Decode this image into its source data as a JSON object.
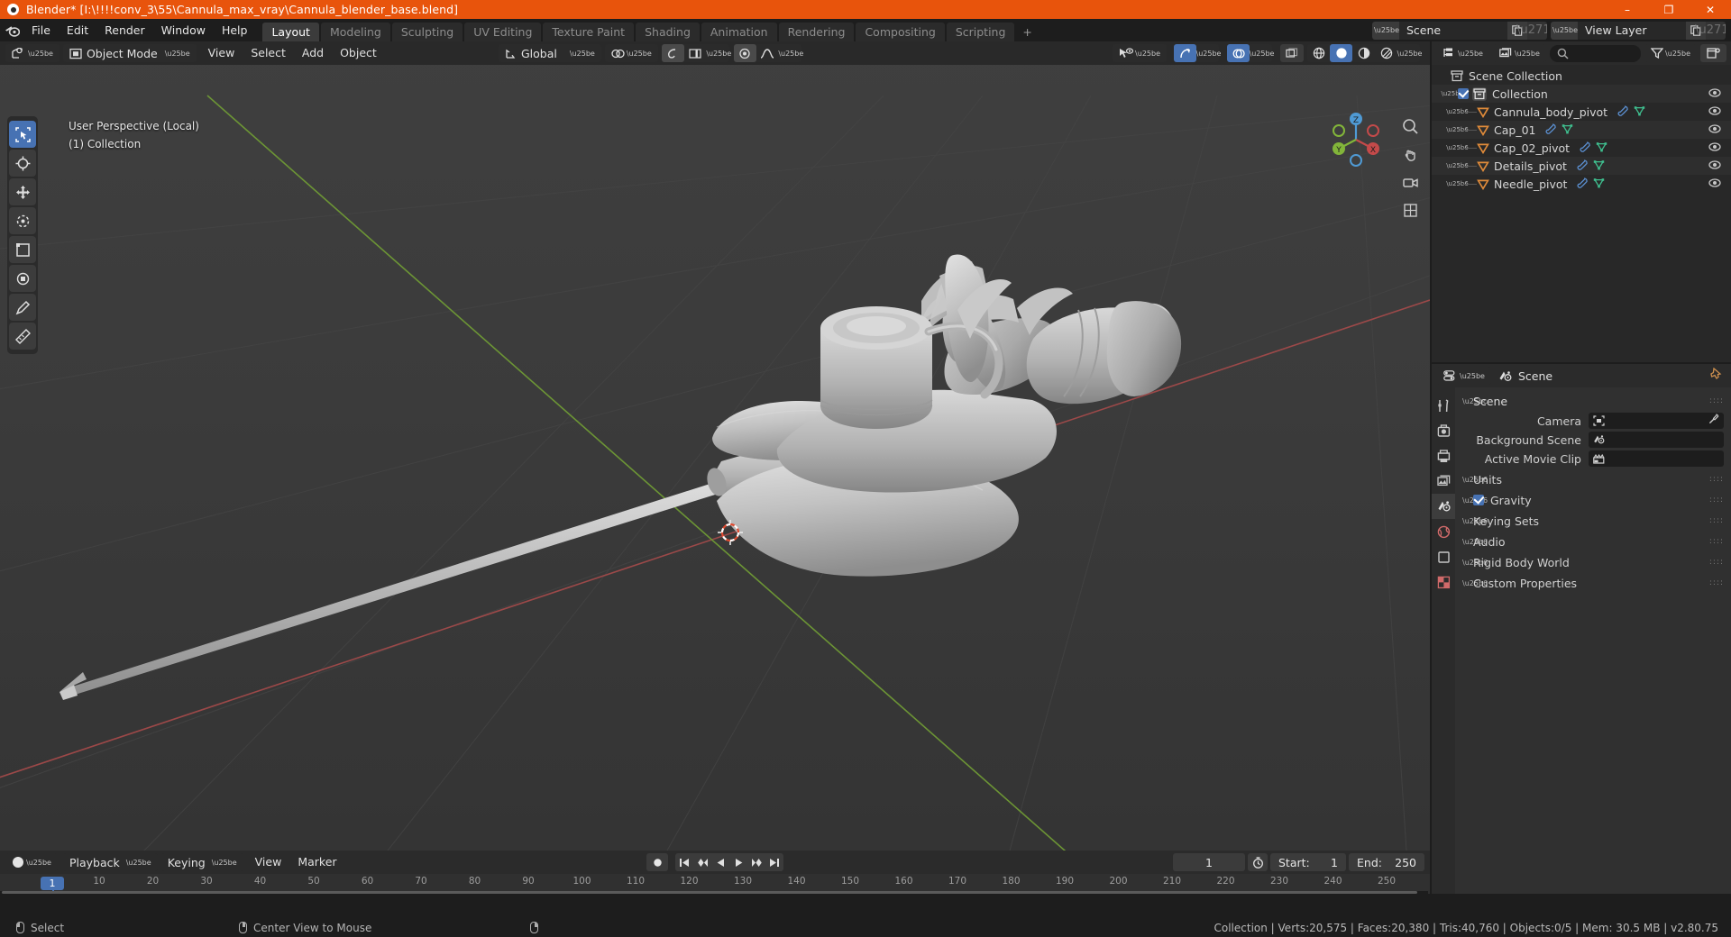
{
  "window": {
    "title": "Blender* [I:\\!!!!conv_3\\55\\Cannula_max_vray\\Cannula_blender_base.blend]",
    "minimize": "–",
    "maximize": "❐",
    "close": "✕"
  },
  "topbar": {
    "menus": [
      "File",
      "Edit",
      "Render",
      "Window",
      "Help"
    ],
    "workspaces": [
      {
        "label": "Layout",
        "active": true
      },
      {
        "label": "Modeling",
        "active": false
      },
      {
        "label": "Sculpting",
        "active": false
      },
      {
        "label": "UV Editing",
        "active": false
      },
      {
        "label": "Texture Paint",
        "active": false
      },
      {
        "label": "Shading",
        "active": false
      },
      {
        "label": "Animation",
        "active": false
      },
      {
        "label": "Rendering",
        "active": false
      },
      {
        "label": "Compositing",
        "active": false
      },
      {
        "label": "Scripting",
        "active": false
      }
    ],
    "add_workspace": "+",
    "scene_name": "Scene",
    "view_layer_name": "View Layer"
  },
  "viewport": {
    "mode": "Object Mode",
    "menus": [
      "View",
      "Select",
      "Add",
      "Object"
    ],
    "transform_orientation": "Global",
    "overlay_text_line1": "User Perspective (Local)",
    "overlay_text_line2": "(1) Collection",
    "gizmo_axes": {
      "x": "X",
      "y": "Y",
      "z": "Z"
    }
  },
  "outliner": {
    "search_placeholder": "",
    "root": "Scene Collection",
    "collection": "Collection",
    "items": [
      {
        "label": "Cannula_body_pivot"
      },
      {
        "label": "Cap_01"
      },
      {
        "label": "Cap_02_pivot"
      },
      {
        "label": "Details_pivot"
      },
      {
        "label": "Needle_pivot"
      }
    ]
  },
  "properties": {
    "breadcrumb": "Scene",
    "panel_title": "Scene",
    "rows": [
      {
        "label": "Camera",
        "value": ""
      },
      {
        "label": "Background Scene",
        "value": ""
      },
      {
        "label": "Active Movie Clip",
        "value": ""
      }
    ],
    "subpanels": [
      {
        "label": "Units",
        "checkbox": false
      },
      {
        "label": "Gravity",
        "checkbox": true
      },
      {
        "label": "Keying Sets",
        "checkbox": false
      },
      {
        "label": "Audio",
        "checkbox": false
      },
      {
        "label": "Rigid Body World",
        "checkbox": false
      },
      {
        "label": "Custom Properties",
        "checkbox": false
      }
    ]
  },
  "timeline": {
    "menus": [
      "Playback",
      "Keying",
      "View",
      "Marker"
    ],
    "current_frame": "1",
    "start_label": "Start:",
    "start_value": "1",
    "end_label": "End:",
    "end_value": "250",
    "ticks": [
      "10",
      "20",
      "30",
      "40",
      "50",
      "60",
      "70",
      "80",
      "90",
      "100",
      "110",
      "120",
      "130",
      "140",
      "150",
      "160",
      "170",
      "180",
      "190",
      "200",
      "210",
      "220",
      "230",
      "240",
      "250"
    ],
    "playhead_frame": "1"
  },
  "statusbar": {
    "left_items": [
      {
        "icon": "mouse-left-icon",
        "label": "Select"
      },
      {
        "icon": "mouse-middle-icon",
        "label": "Center View to Mouse"
      },
      {
        "icon": "mouse-right-icon",
        "label": ""
      }
    ],
    "right_text": "Collection | Verts:20,575 | Faces:20,380 | Tris:40,760 | Objects:0/5 | Mem: 30.5 MB | v2.80.75"
  },
  "colors": {
    "accent_orange": "#e8540c",
    "accent_blue": "#4772b3",
    "axis_x_red": "#b54b4b",
    "axis_y_green": "#7aa23c",
    "object_grey": "#b9b9b9",
    "viewport_bg": "#393939"
  }
}
